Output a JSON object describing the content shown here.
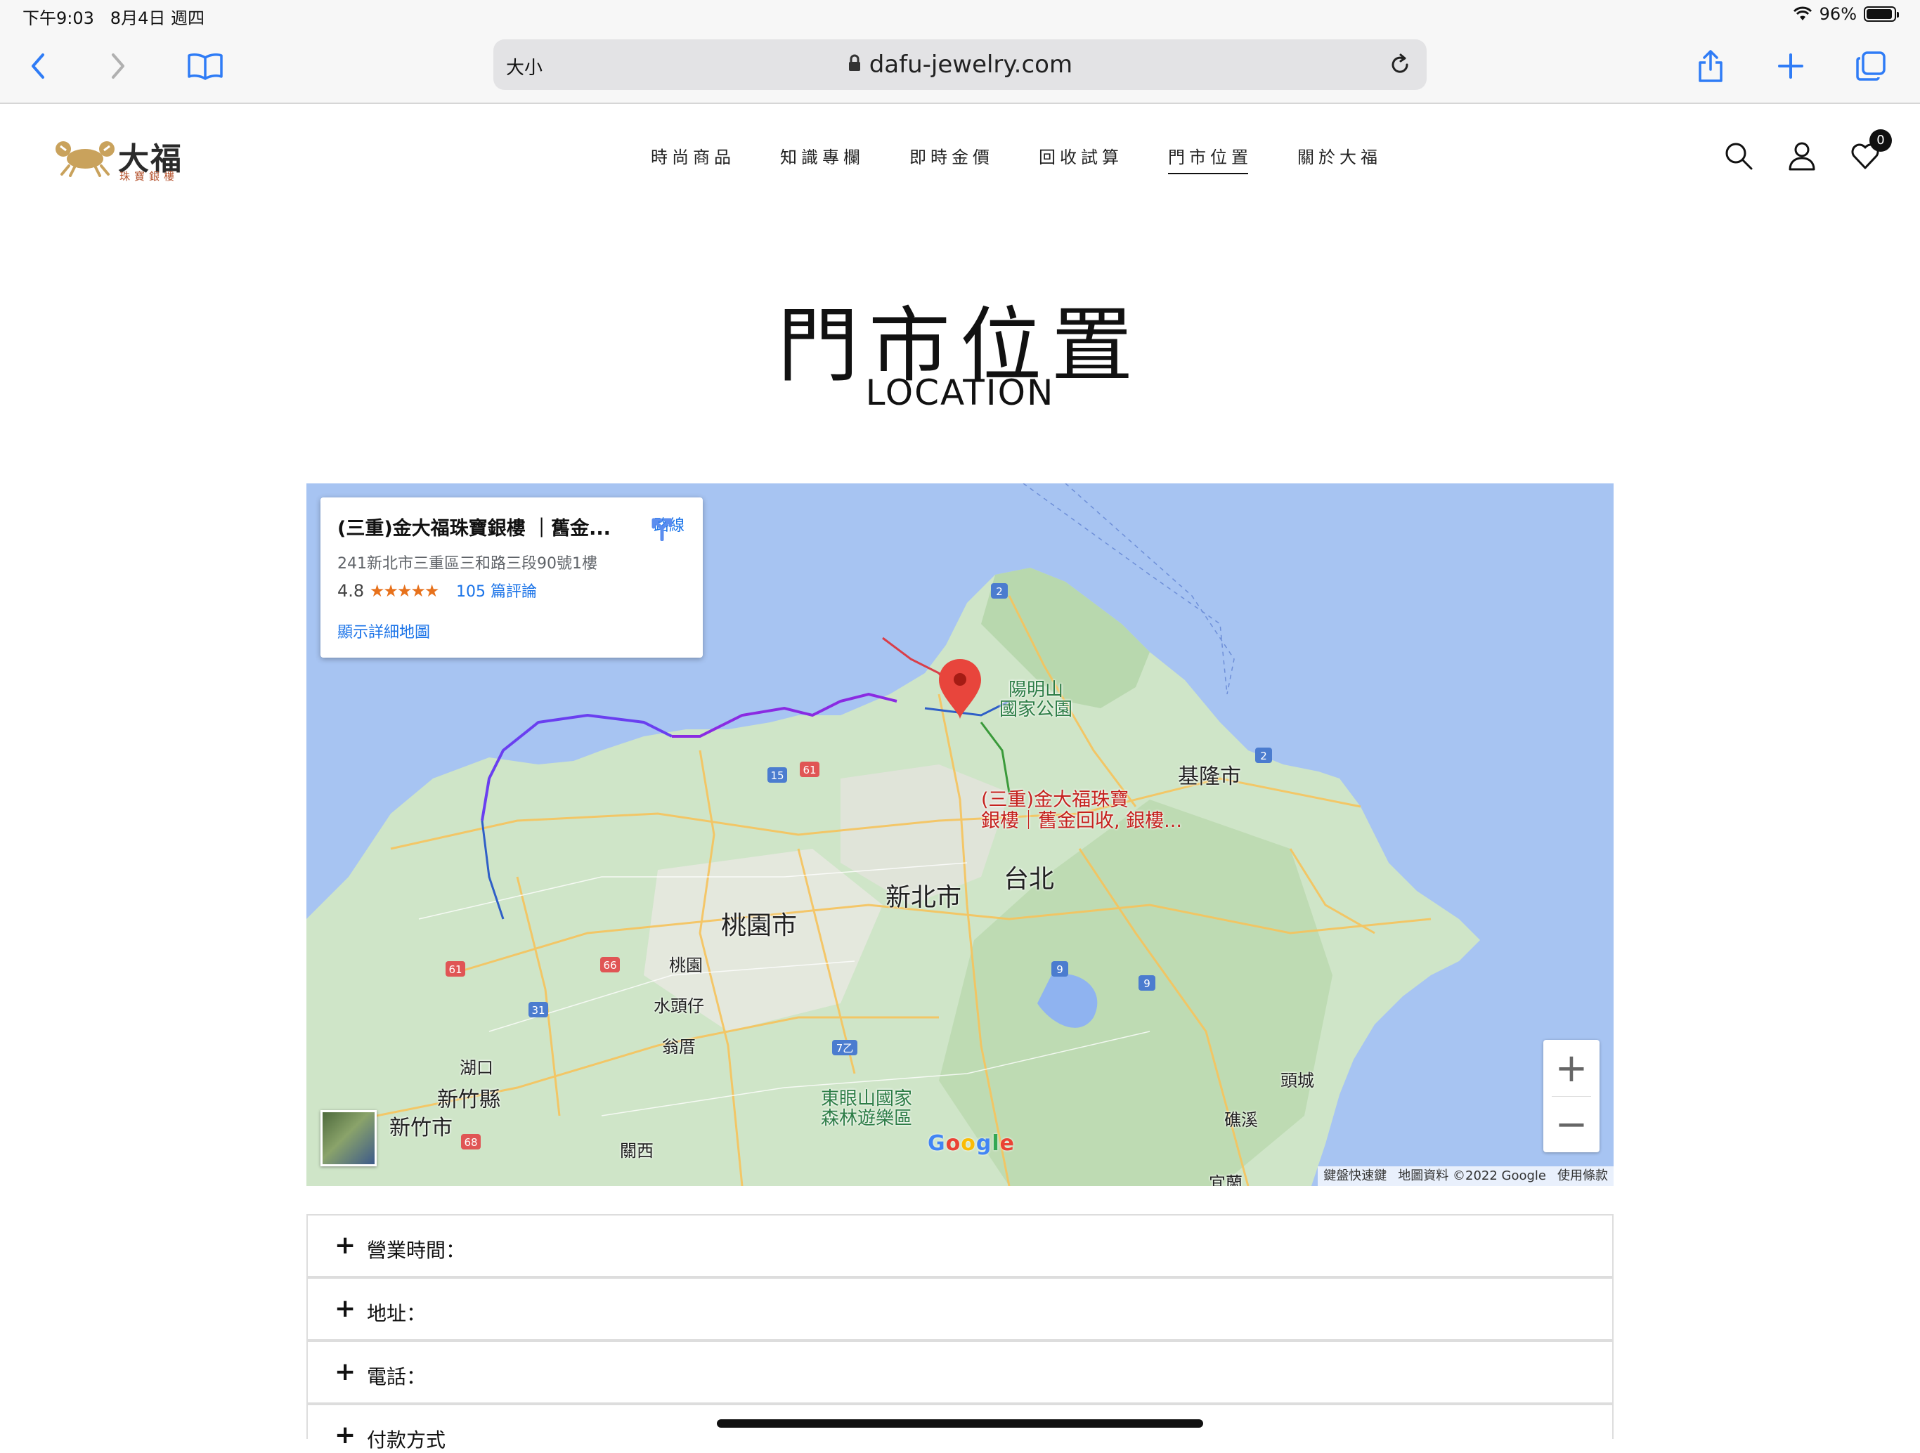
{
  "status_bar": {
    "time": "下午9:03",
    "date": "8月4日 週四",
    "battery": "96%"
  },
  "browser": {
    "text_size": "大小",
    "url": "dafu-jewelry.com"
  },
  "site": {
    "logo_main": "大福",
    "logo_sub": "珠寶銀樓",
    "nav": [
      "時尚商品",
      "知識專欄",
      "即時金價",
      "回收試算",
      "門市位置",
      "關於大福"
    ],
    "wishlist_count": "0"
  },
  "page": {
    "title": "門市位置",
    "subtitle": "LOCATION"
  },
  "map": {
    "place_name": "(三重)金大福珠寶銀樓 ｜舊金...",
    "place_address": "241新北市三重區三和路三段90號1樓",
    "rating": "4.8",
    "stars": "★★★★★",
    "reviews": "105 篇評論",
    "view_larger": "顯示詳細地圖",
    "directions": "路線",
    "labels": {
      "yangmingshan": "陽明山\n國家公園",
      "keelung": "基隆市",
      "taipei": "台北",
      "new_taipei": "新北市",
      "taoyuan_city": "桃園市",
      "taoyuan": "桃園",
      "shuitouzi": "水頭仔",
      "wengcuo": "翁厝",
      "hukou": "湖口",
      "hsinchu_county": "新竹縣",
      "hsinchu_city": "新竹市",
      "guanxi": "關西",
      "dongyan": "東眼山國家\n森林遊樂區",
      "toucheng": "頭城",
      "jiaoxi": "礁溪",
      "yilan": "宜蘭",
      "pin": "(三重)金大福珠寶\n銀樓｜舊金回收, 銀樓..."
    },
    "google": "Google",
    "attribution": [
      "鍵盤快速鍵",
      "地圖資料 ©2022 Google",
      "使用條款"
    ]
  },
  "accordion": [
    "營業時間：",
    "地址：",
    "電話：",
    "付款方式"
  ]
}
